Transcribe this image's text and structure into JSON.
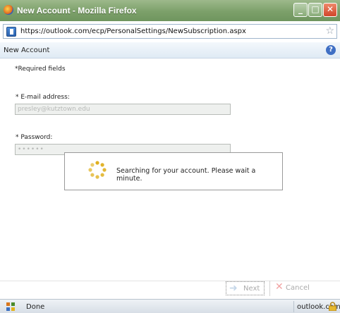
{
  "window": {
    "title": "New Account - Mozilla Firefox",
    "url": "https://outlook.com/ecp/PersonalSettings/NewSubscription.aspx",
    "controls": {
      "minimize": "_",
      "maximize": "□",
      "close": "✕"
    }
  },
  "header": {
    "title": "New Account"
  },
  "form": {
    "required_note": "*Required fields",
    "email_label": "* E-mail address:",
    "email_value": "presley@kutztown.edu",
    "password_label": "* Password:",
    "password_value": "••••••"
  },
  "popup": {
    "message": "Searching for your account. Please wait a minute."
  },
  "buttons": {
    "next": "Next",
    "cancel": "Cancel"
  },
  "status": {
    "text": "Done",
    "domain": "outlook.com"
  },
  "colors": {
    "titlebar": "#7ca06a",
    "header_bar": "#e6eef6",
    "spinner": "#e0b020",
    "cancel_x": "#f1a4a4"
  },
  "icons": [
    "firefox-logo-icon",
    "page-icon",
    "star-icon",
    "help-icon",
    "spinner-icon",
    "next-arrow-icon",
    "cancel-x-icon",
    "status-grid-icon",
    "lock-icon"
  ]
}
